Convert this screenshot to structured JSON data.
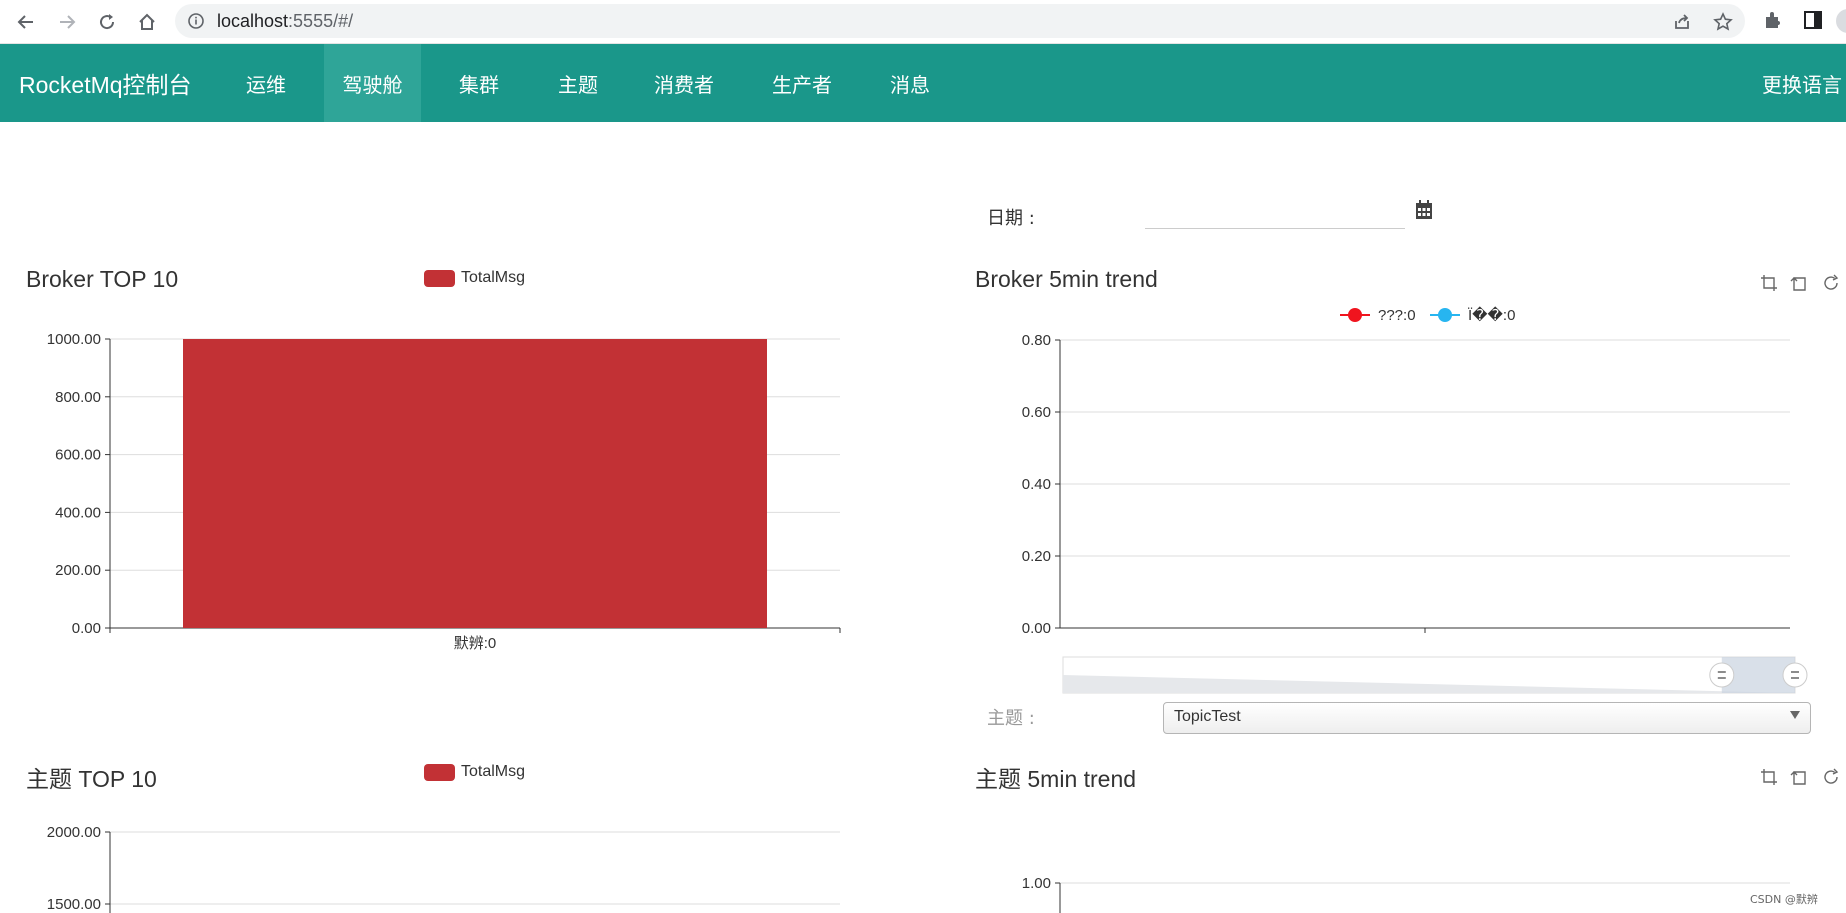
{
  "browser": {
    "url_host": "localhost",
    "url_rest": ":5555/#/"
  },
  "app": {
    "brand": "RocketMq控制台",
    "nav_items": [
      "运维",
      "驾驶舱",
      "集群",
      "主题",
      "消费者",
      "生产者",
      "消息"
    ],
    "active_nav": "驾驶舱",
    "language_button": "更换语言"
  },
  "filters": {
    "date_label": "日期 :",
    "date_value": "",
    "topic_label": "主题 :",
    "topic_selected": "TopicTest"
  },
  "colors": {
    "navbar": "#1a978a",
    "nav_active": "#2fa598",
    "bar": "#c23135",
    "series_red": "#f0141e",
    "series_blue": "#27b5f0"
  },
  "icons": {
    "back": "arrow-left-icon",
    "forward": "arrow-right-icon",
    "reload": "reload-icon",
    "home": "home-icon",
    "info": "info-icon",
    "share": "share-icon",
    "bookmark": "star-icon",
    "extensions": "puzzle-icon",
    "sidepanel": "side-panel-icon",
    "calendar": "calendar-icon",
    "zoom": "zoom-icon",
    "zoom_reset": "zoom-reset-icon",
    "restore": "restore-icon"
  },
  "chart_data": [
    {
      "id": "broker_top10",
      "type": "bar",
      "title": "Broker TOP 10",
      "legend": [
        "TotalMsg"
      ],
      "categories": [
        "默辨:0"
      ],
      "series": [
        {
          "name": "TotalMsg",
          "values": [
            1000
          ]
        }
      ],
      "ylim": [
        0,
        1000
      ],
      "yticks": [
        "0.00",
        "200.00",
        "400.00",
        "600.00",
        "800.00",
        "1000.00"
      ],
      "grid": true
    },
    {
      "id": "broker_trend",
      "type": "line",
      "title": "Broker 5min trend",
      "legend": [
        "???:0",
        "Ï��:0"
      ],
      "series": [
        {
          "name": "???:0",
          "values": []
        },
        {
          "name": "Ï��:0",
          "values": []
        }
      ],
      "ylim": [
        0,
        0.8
      ],
      "yticks": [
        "0.00",
        "0.20",
        "0.40",
        "0.60",
        "0.80"
      ],
      "grid": true,
      "datazoom": {
        "start": 0.9,
        "end": 1.0
      }
    },
    {
      "id": "topic_top10",
      "type": "bar",
      "title": "主题 TOP 10",
      "legend": [
        "TotalMsg"
      ],
      "series": [
        {
          "name": "TotalMsg",
          "values": []
        }
      ],
      "yticks": [
        "1500.00",
        "2000.00"
      ],
      "grid": true
    },
    {
      "id": "topic_trend",
      "type": "line",
      "title": "主题 5min trend",
      "series": [],
      "yticks": [
        "1.00"
      ],
      "grid": true
    }
  ],
  "watermark": "CSDN @默辨"
}
